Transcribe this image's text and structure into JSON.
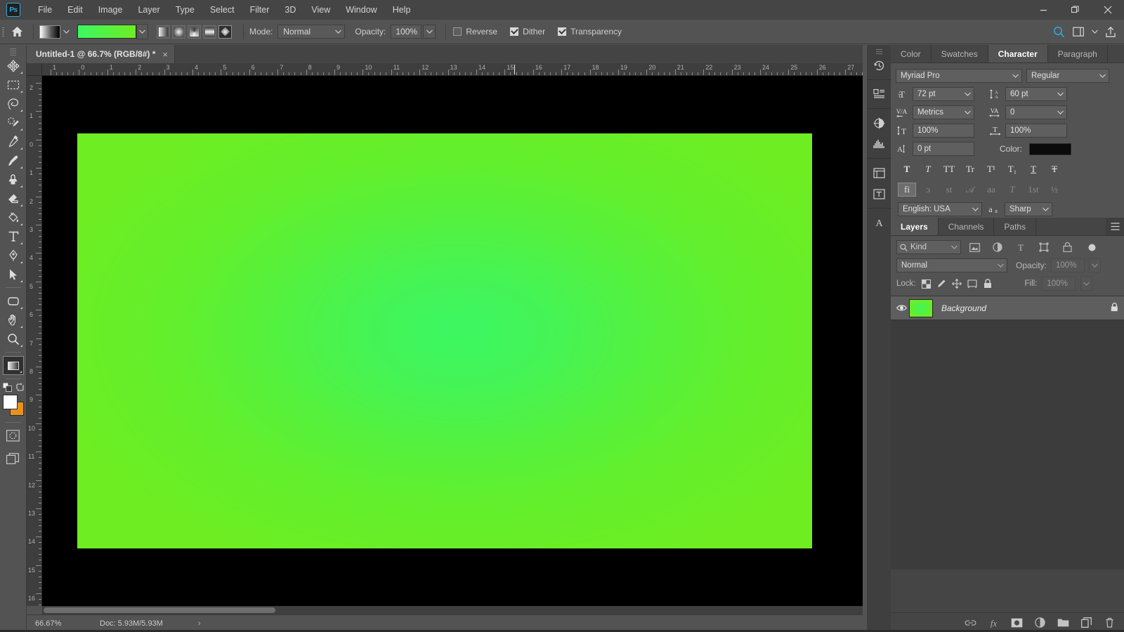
{
  "app": {
    "logo": "Ps",
    "menu": [
      "File",
      "Edit",
      "Image",
      "Layer",
      "Type",
      "Select",
      "Filter",
      "3D",
      "View",
      "Window",
      "Help"
    ],
    "window_controls": {
      "minimize": "minimize-icon",
      "restore": "restore-icon",
      "close": "close-icon"
    }
  },
  "options_bar": {
    "home_icon": "home-icon",
    "gradient_preset_icon": "gradient-preset-picker",
    "gradient_swatch_colors": [
      "#3cf763",
      "#6eed22"
    ],
    "gradient_types": [
      {
        "name": "linear-gradient",
        "label": "Linear Gradient",
        "active": false
      },
      {
        "name": "radial-gradient",
        "label": "Radial Gradient",
        "active": false
      },
      {
        "name": "angle-gradient",
        "label": "Angle Gradient",
        "active": false
      },
      {
        "name": "reflected-gradient",
        "label": "Reflected Gradient",
        "active": false
      },
      {
        "name": "diamond-gradient",
        "label": "Diamond Gradient",
        "active": true
      }
    ],
    "mode_label": "Mode:",
    "mode_value": "Normal",
    "opacity_label": "Opacity:",
    "opacity_value": "100%",
    "reverse_label": "Reverse",
    "reverse_checked": false,
    "dither_label": "Dither",
    "dither_checked": true,
    "transparency_label": "Transparency",
    "transparency_checked": true,
    "search_icon": "search-icon",
    "workspace_icon": "workspace-icon",
    "share_icon": "share-icon"
  },
  "document": {
    "tab_title": "Untitled-1 @ 66.7% (RGB/8#) *",
    "close_glyph": "×",
    "canvas": {
      "gradient_center_color": "#3cf763",
      "gradient_edge_color": "#6eed22",
      "background_color": "#000000"
    }
  },
  "rulers": {
    "horizontal_labels": [
      "1",
      "0",
      "1",
      "2",
      "3",
      "4",
      "5",
      "6",
      "7",
      "8",
      "9",
      "10",
      "11",
      "12",
      "13",
      "14",
      "15",
      "16",
      "17",
      "18",
      "19",
      "20",
      "21",
      "22",
      "23",
      "24",
      "25",
      "26",
      "27"
    ],
    "vertical_labels": [
      "2",
      "1",
      "0",
      "1",
      "2",
      "3",
      "4",
      "5",
      "6",
      "7",
      "8",
      "9",
      "10",
      "11",
      "12",
      "13",
      "14",
      "15",
      "16"
    ]
  },
  "toolbar": {
    "tools": [
      {
        "name": "move-tool",
        "label": "Move Tool",
        "glyph": "move",
        "active": false
      },
      {
        "name": "marquee-tool",
        "label": "Rectangular Marquee Tool",
        "glyph": "marquee",
        "active": false
      },
      {
        "name": "lasso-tool",
        "label": "Lasso Tool",
        "glyph": "lasso",
        "active": false
      },
      {
        "name": "quick-selection-tool",
        "label": "Quick Selection Tool",
        "glyph": "quickselect",
        "active": false
      },
      {
        "name": "eyedropper-tool",
        "label": "Eyedropper Tool",
        "glyph": "eyedropper",
        "active": false
      },
      {
        "name": "brush-tool",
        "label": "Brush Tool",
        "glyph": "brush",
        "active": false
      },
      {
        "name": "clone-stamp-tool",
        "label": "Clone Stamp Tool",
        "glyph": "stamp",
        "active": false
      },
      {
        "name": "eraser-tool",
        "label": "Eraser Tool",
        "glyph": "eraser",
        "active": false
      },
      {
        "name": "paint-bucket-tool",
        "label": "Paint Bucket Tool",
        "glyph": "bucket",
        "active": false
      },
      {
        "name": "type-tool",
        "label": "Horizontal Type Tool",
        "glyph": "type",
        "active": false
      },
      {
        "name": "pen-tool",
        "label": "Pen Tool",
        "glyph": "pen",
        "active": false
      },
      {
        "name": "path-selection-tool",
        "label": "Path Selection Tool",
        "glyph": "pathselect",
        "active": false
      },
      {
        "name": "rectangle-tool",
        "label": "Rectangle Tool",
        "glyph": "rectangle",
        "active": false
      },
      {
        "name": "hand-tool",
        "label": "Hand Tool",
        "glyph": "hand",
        "active": false
      },
      {
        "name": "zoom-tool",
        "label": "Zoom Tool",
        "glyph": "zoom",
        "active": false
      },
      {
        "name": "gradient-tool",
        "label": "Gradient Tool",
        "glyph": "gradient",
        "active": true
      }
    ],
    "foreground_color": "#ffffff",
    "background_color": "#e8921c",
    "quick_mask_icon": "quick-mask-icon",
    "screen_mode_icon": "screen-mode-icon"
  },
  "status_bar": {
    "zoom": "66.67%",
    "doc_label": "Doc: 5.93M/5.93M",
    "arrow": "›"
  },
  "icon_dock": {
    "icons": [
      {
        "name": "history-icon",
        "label": "History"
      },
      {
        "name": "actions-icon",
        "label": "Actions"
      },
      {
        "name": "adjustments-icon",
        "label": "Adjustments"
      },
      {
        "name": "histogram-icon",
        "label": "Histogram"
      },
      {
        "name": "properties-icon",
        "label": "Properties"
      },
      {
        "name": "character-styles-icon",
        "label": "Character Styles"
      },
      {
        "name": "glyphs-icon",
        "label": "Glyphs"
      }
    ]
  },
  "character_panel": {
    "tabs": [
      {
        "name": "tab-color",
        "label": "Color",
        "active": false
      },
      {
        "name": "tab-swatches",
        "label": "Swatches",
        "active": false
      },
      {
        "name": "tab-character",
        "label": "Character",
        "active": true
      },
      {
        "name": "tab-paragraph",
        "label": "Paragraph",
        "active": false
      }
    ],
    "font_family": "Myriad Pro",
    "font_style": "Regular",
    "font_size": "72 pt",
    "leading": "60 pt",
    "kerning": "Metrics",
    "tracking": "0",
    "vertical_scale": "100%",
    "horizontal_scale": "100%",
    "baseline_shift": "0 pt",
    "color_label": "Color:",
    "color_value": "#0b0b0b",
    "style_buttons": [
      {
        "name": "faux-bold-button",
        "glyph": "T",
        "on": false
      },
      {
        "name": "faux-italic-button",
        "glyph": "T",
        "on": false
      },
      {
        "name": "all-caps-button",
        "glyph": "TT",
        "on": false
      },
      {
        "name": "small-caps-button",
        "glyph": "Tr",
        "on": false
      },
      {
        "name": "superscript-button",
        "glyph": "T¹",
        "on": false
      },
      {
        "name": "subscript-button",
        "glyph": "T₁",
        "on": false
      },
      {
        "name": "underline-button",
        "glyph": "T",
        "on": false
      },
      {
        "name": "strikethrough-button",
        "glyph": "Ŧ",
        "on": false
      }
    ],
    "opentype_buttons": [
      {
        "name": "standard-ligatures-button",
        "glyph": "fi",
        "on": true
      },
      {
        "name": "contextual-alternates-button",
        "glyph": "ɔ",
        "on": false
      },
      {
        "name": "discretionary-ligatures-button",
        "glyph": "st",
        "on": false
      },
      {
        "name": "swash-button",
        "glyph": "𝒜",
        "on": false
      },
      {
        "name": "stylistic-alternates-button",
        "glyph": "aa",
        "on": false
      },
      {
        "name": "titling-alternates-button",
        "glyph": "T",
        "on": false
      },
      {
        "name": "ordinals-button",
        "glyph": "1st",
        "on": false
      },
      {
        "name": "fractions-button",
        "glyph": "½",
        "on": false
      }
    ],
    "language": "English: USA",
    "antialias_icon": "aa-icon",
    "antialias_method": "Sharp"
  },
  "layers_panel": {
    "tabs": [
      {
        "name": "tab-layers",
        "label": "Layers",
        "active": true
      },
      {
        "name": "tab-channels",
        "label": "Channels",
        "active": false
      },
      {
        "name": "tab-paths",
        "label": "Paths",
        "active": false
      }
    ],
    "filter_kind": "Kind",
    "filter_icons": [
      {
        "name": "filter-pixel-icon",
        "label": "Pixel Layers"
      },
      {
        "name": "filter-adjustment-icon",
        "label": "Adjustment Layers"
      },
      {
        "name": "filter-type-icon",
        "label": "Type Layers"
      },
      {
        "name": "filter-shape-icon",
        "label": "Shape Layers"
      },
      {
        "name": "filter-smart-object-icon",
        "label": "Smart Objects"
      }
    ],
    "filter_toggle": "filter-power-toggle",
    "blend_mode": "Normal",
    "opacity_label": "Opacity:",
    "opacity_value": "100%",
    "lock_label": "Lock:",
    "lock_icons": [
      {
        "name": "lock-transparent-pixels-icon",
        "label": "Lock transparent pixels"
      },
      {
        "name": "lock-image-pixels-icon",
        "label": "Lock image pixels"
      },
      {
        "name": "lock-position-icon",
        "label": "Lock position"
      },
      {
        "name": "lock-artboard-nesting-icon",
        "label": "Prevent auto-nesting"
      },
      {
        "name": "lock-all-icon",
        "label": "Lock all"
      }
    ],
    "fill_label": "Fill:",
    "fill_value": "100%",
    "layers": [
      {
        "name": "Background",
        "visible": true,
        "locked": true,
        "thumbnail_colors": [
          "#3cf763",
          "#6eed22"
        ]
      }
    ],
    "footer_buttons": [
      {
        "name": "link-layers-button",
        "label": "Link layers"
      },
      {
        "name": "layer-style-button",
        "label": "Add a layer style"
      },
      {
        "name": "layer-mask-button",
        "label": "Add layer mask"
      },
      {
        "name": "new-adjustment-layer-button",
        "label": "New fill or adjustment layer"
      },
      {
        "name": "new-group-button",
        "label": "Create a new group"
      },
      {
        "name": "new-layer-button",
        "label": "Create a new layer"
      },
      {
        "name": "delete-layer-button",
        "label": "Delete layer"
      }
    ]
  }
}
